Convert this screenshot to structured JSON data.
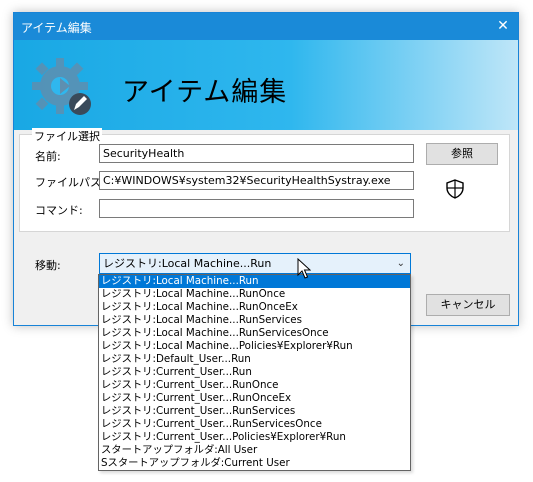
{
  "window": {
    "title": "アイテム編集",
    "close_glyph": "✕"
  },
  "banner": {
    "title": "アイテム編集",
    "icon": "gear-edit-icon"
  },
  "file_group": {
    "legend": "ファイル選択",
    "name_label": "名前:",
    "name_value": "SecurityHealth",
    "path_label": "ファイルパス:",
    "path_value": "C:¥WINDOWS¥system32¥SecurityHealthSystray.exe",
    "command_label": "コマンド:",
    "command_value": "",
    "browse_label": "参照",
    "icon": "shield-icon"
  },
  "move": {
    "label": "移動:",
    "selected": "レジストリ:Local Machine...Run",
    "options": [
      "レジストリ:Local Machine...Run",
      "レジストリ:Local Machine...RunOnce",
      "レジストリ:Local Machine...RunOnceEx",
      "レジストリ:Local Machine...RunServices",
      "レジストリ:Local Machine...RunServicesOnce",
      "レジストリ:Local Machine...Policies¥Explorer¥Run",
      "レジストリ:Default_User...Run",
      "レジストリ:Current_User...Run",
      "レジストリ:Current_User...RunOnce",
      "レジストリ:Current_User...RunOnceEx",
      "レジストリ:Current_User...RunServices",
      "レジストリ:Current_User...RunServicesOnce",
      "レジストリ:Current_User...Policies¥Explorer¥Run",
      "スタートアップフォルダ:All User",
      "Sスタートアップフォルダ:Current User"
    ]
  },
  "buttons": {
    "cancel_label": "キャンセル"
  }
}
